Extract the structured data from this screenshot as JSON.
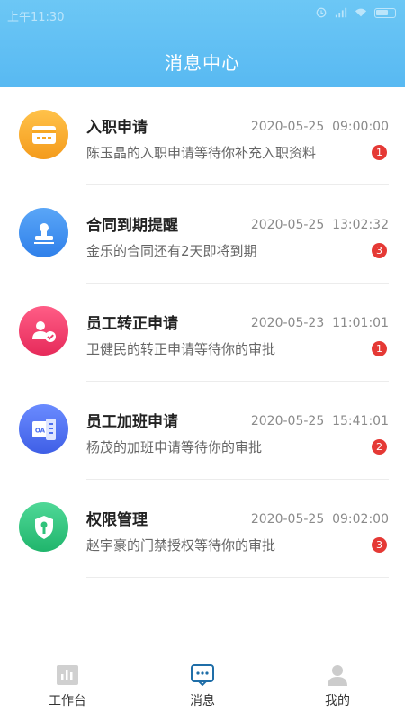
{
  "status_bar": {
    "time": "上午11:30"
  },
  "header": {
    "title": "消息中心"
  },
  "colors": {
    "header": "#5ebdf3",
    "badge": "#e53935",
    "tab_active": "#1f6ea8",
    "tab_inactive": "#c8c8c8"
  },
  "messages": [
    {
      "icon": "card-icon",
      "icon_color": "#f7a823",
      "title": "入职申请",
      "time": "2020-05-25  09:00:00",
      "desc": "陈玉晶的入职申请等待你补充入职资料",
      "badge": "1"
    },
    {
      "icon": "stamp-icon",
      "icon_color": "#3b8df0",
      "title": "合同到期提醒",
      "time": "2020-05-25  13:02:32",
      "desc": "金乐的合同还有2天即将到期",
      "badge": "3"
    },
    {
      "icon": "user-check-icon",
      "icon_color": "#ee3d6a",
      "title": "员工转正申请",
      "time": "2020-05-23  11:01:01",
      "desc": "卫健民的转正申请等待你的审批",
      "badge": "1"
    },
    {
      "icon": "oa-document-icon",
      "icon_color": "#4c6ff0",
      "title": "员工加班申请",
      "time": "2020-05-25  15:41:01",
      "desc": "杨茂的加班申请等待你的审批",
      "badge": "2"
    },
    {
      "icon": "shield-key-icon",
      "icon_color": "#2fc37b",
      "title": "权限管理",
      "time": "2020-05-25  09:02:00",
      "desc": "赵宇豪的门禁授权等待你的审批",
      "badge": "3"
    }
  ],
  "tabbar": {
    "tabs": [
      {
        "label": "工作台",
        "icon": "chart-icon",
        "active": false
      },
      {
        "label": "消息",
        "icon": "message-icon",
        "active": true
      },
      {
        "label": "我的",
        "icon": "profile-icon",
        "active": false
      }
    ]
  }
}
